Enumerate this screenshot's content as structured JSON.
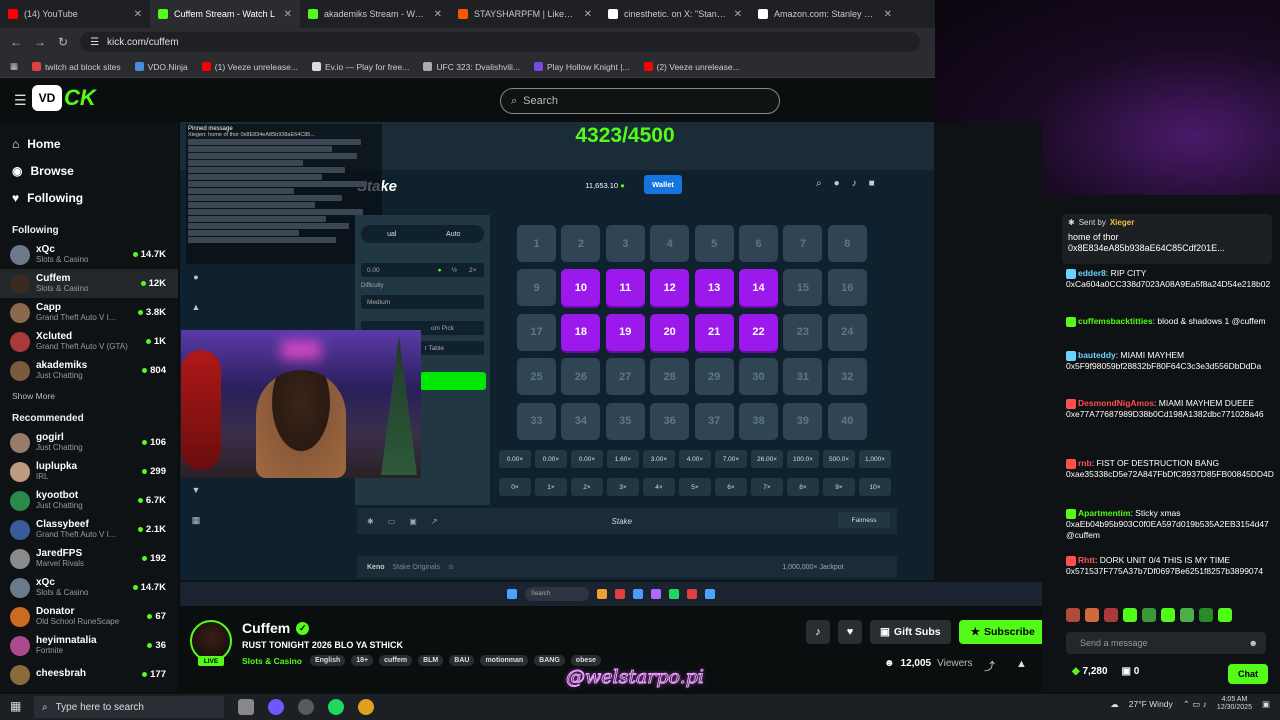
{
  "browser": {
    "tabs": [
      {
        "label": "(14) YouTube",
        "color": "#ff0000"
      },
      {
        "label": "Cuffem Stream - Watch L",
        "color": "#53fc18"
      },
      {
        "label": "akademiks Stream - Watch L",
        "color": "#53fc18"
      },
      {
        "label": "STAYSHARPFM | Liked tracks",
        "color": "#ff5500"
      },
      {
        "label": "cinesthetic. on X: \"Stanley Ku",
        "color": "#ffffff"
      },
      {
        "label": "Amazon.com: Stanley Kubrick",
        "color": "#ffffff"
      }
    ],
    "url": "kick.com/cuffem",
    "bookmarks": [
      "twitch ad block sites",
      "VDO.Ninja",
      "(1) Veeze unrelease...",
      "Ev.io — Play for free...",
      "UFC 323: Dvalishvili...",
      "Play Hollow Knight |...",
      "(2) Veeze unrelease..."
    ]
  },
  "header": {
    "logo_badge": "VD",
    "logo_text": "CK",
    "search_placeholder": "Search",
    "goal_counter": "4323/4500"
  },
  "sidebar": {
    "nav": [
      {
        "label": "Home",
        "icon": "home-icon",
        "glyph": "⌂"
      },
      {
        "label": "Browse",
        "icon": "browse-icon",
        "glyph": "◉"
      },
      {
        "label": "Following",
        "icon": "heart-icon",
        "glyph": "♥"
      }
    ],
    "following_title": "Following",
    "following": [
      {
        "name": "xQc",
        "category": "Slots & Casino",
        "viewers": "14.7K",
        "color": "#6a7a8a"
      },
      {
        "name": "Cuffem",
        "category": "Slots & Casino",
        "viewers": "12K",
        "color": "#3a2a20"
      },
      {
        "name": "Capp",
        "category": "Grand Theft Auto V I...",
        "viewers": "3.8K",
        "color": "#8a6a4a"
      },
      {
        "name": "Xcluted",
        "category": "Grand Theft Auto V (GTA)",
        "viewers": "1K",
        "color": "#aa3a3a"
      },
      {
        "name": "akademiks",
        "category": "Just Chatting",
        "viewers": "804",
        "color": "#7a5a3a"
      }
    ],
    "show_more": "Show More",
    "recommended_title": "Recommended",
    "recommended": [
      {
        "name": "gogirl",
        "category": "Just Chatting",
        "viewers": "106",
        "color": "#9a7a6a"
      },
      {
        "name": "luplupka",
        "category": "IRL",
        "viewers": "299",
        "color": "#c09a80"
      },
      {
        "name": "kyootbot",
        "category": "Just Chatting",
        "viewers": "6.7K",
        "color": "#2a8a4a"
      },
      {
        "name": "Classybeef",
        "category": "Grand Theft Auto V I...",
        "viewers": "2.1K",
        "color": "#3a5a9a"
      },
      {
        "name": "JaredFPS",
        "category": "Marvel Rivals",
        "viewers": "192",
        "color": "#8a8a8a"
      },
      {
        "name": "xQc",
        "category": "Slots & Casino",
        "viewers": "14.7K",
        "color": "#6a7a8a"
      },
      {
        "name": "Donator",
        "category": "Old School RuneScape",
        "viewers": "67",
        "color": "#cc6a20"
      },
      {
        "name": "heyimnatalia",
        "category": "Fortnite",
        "viewers": "36",
        "color": "#aa4a8a"
      },
      {
        "name": "cheesbrah",
        "category": "",
        "viewers": "177",
        "color": "#8a6a3a"
      }
    ]
  },
  "stake": {
    "logo": "Stake",
    "balance": "11,653.10",
    "wallet_label": "Wallet",
    "mode_manual": "ual",
    "mode_auto": "Auto",
    "bet_amount": "0.00",
    "half_label": "½",
    "double_label": "2×",
    "difficulty_label": "Difficulty",
    "difficulty_value": "Medium",
    "random_pick": "om Pick",
    "clear_table": "r Table",
    "cells": [
      "1",
      "2",
      "3",
      "4",
      "5",
      "6",
      "7",
      "8",
      "9",
      "10",
      "11",
      "12",
      "13",
      "14",
      "15",
      "16",
      "17",
      "18",
      "19",
      "20",
      "21",
      "22",
      "23",
      "24",
      "25",
      "26",
      "27",
      "28",
      "29",
      "30",
      "31",
      "32",
      "33",
      "34",
      "35",
      "36",
      "37",
      "38",
      "39",
      "40"
    ],
    "selected": [
      "10",
      "11",
      "12",
      "13",
      "14",
      "18",
      "19",
      "20",
      "21",
      "22"
    ],
    "payouts": [
      "0.00×",
      "0.00×",
      "0.00×",
      "1.60×",
      "3.00×",
      "4.00×",
      "7.00×",
      "26.00×",
      "100.0×",
      "500.0×",
      "1,000×"
    ],
    "hits": [
      "0×",
      "1×",
      "2×",
      "3×",
      "4×",
      "5×",
      "6×",
      "7×",
      "8×",
      "9×",
      "10×"
    ],
    "fairness_label": "Fairness",
    "footer_logo": "Stake",
    "game_name": "Keno",
    "game_sub": "Stake Originals",
    "jackpot": "1,000,000×",
    "jackpot_label": "Jackpot"
  },
  "pinned": {
    "title": "Pinned message",
    "line": "Xiegen: home of thor 0x8E834eA85b938aE64C85..."
  },
  "taskbar_mini": {
    "search": "Search"
  },
  "stream_info": {
    "name": "Cuffem",
    "live_label": "LIVE",
    "title": "RUST TONIGHT 2026 BLO YA STHICK",
    "category": "Slots & Casino",
    "tags": [
      "English",
      "18+",
      "cuffem",
      "BLM",
      "BAU",
      "motionman",
      "BANG",
      "obese"
    ],
    "gift_subs": "Gift Subs",
    "subscribe": "Subscribe",
    "viewers": "12,005",
    "viewers_label": "Viewers",
    "watermark": "@welstarpo.pi"
  },
  "chat": {
    "sent_by_label": "Sent by",
    "sent_by_user": "Xieger",
    "sent_by_text": "home of thor 0x8E834eA85b938aE64C85Cdf201E...",
    "messages": [
      {
        "user": "edder8",
        "color": "#6ad4ff",
        "text": "RIP CITY",
        "addr": "0xCa604a0CC338d7023A08A9Ea5f8a24D54e218b02"
      },
      {
        "user": "cuffemsbacktitties",
        "color": "#53fc18",
        "text": "blood & shadows 1 @cuffem",
        "addr": ""
      },
      {
        "user": "bauteddy",
        "color": "#6ad4ff",
        "text": "MIAMI MAYHEM",
        "addr": "0x5F9f98059bf28832bF80F64C3c3e3d556DbDdDa"
      },
      {
        "user": "DesmondNigAmos",
        "color": "#ff4f4f",
        "text": "MIAMI MAYHEM DUEEE",
        "addr": "0xe77A77687989D38b0Cd198A1382dbc771028a46"
      },
      {
        "user": "rnb",
        "color": "#ff4f4f",
        "text": "FIST OF DESTRUCTION BANG",
        "addr": "0xae35338cD5e72A847FbDfC8937D85FB00845DD4D"
      },
      {
        "user": "Apartmentim",
        "color": "#53fc18",
        "text": "Sticky xmas",
        "addr": "0xaEb04b95b903C0f0EA597d019b535A2EB3154d47 @cuffem"
      },
      {
        "user": "Rhtt",
        "color": "#ff4f4f",
        "text": "DORK UNIT 0/4 THIS IS MY TIME",
        "addr": "0x571537F775A37b7Df0697Be6251f8257b3899074"
      }
    ],
    "input_placeholder": "Send a message",
    "points": "7,280",
    "count": "0",
    "chat_button": "Chat"
  },
  "taskbar": {
    "search_placeholder": "Type here to search",
    "weather": "27°F  Windy",
    "time": "4:05 AM",
    "date": "12/30/2025"
  }
}
